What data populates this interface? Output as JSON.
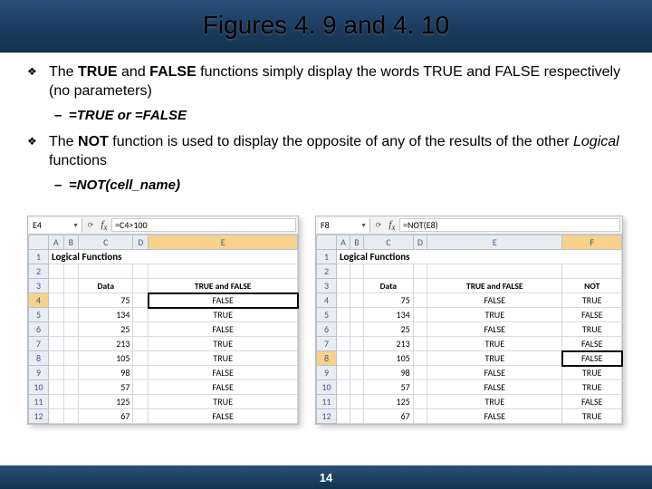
{
  "title": "Figures 4. 9 and 4. 10",
  "bullets": {
    "b1_pre": "The ",
    "b1_bold1": "TRUE",
    "b1_mid1": " and ",
    "b1_bold2": "FALSE",
    "b1_post": " functions simply display the words TRUE and FALSE respectively (no parameters)",
    "b1_sub": "=TRUE or =FALSE",
    "b2_pre": "The ",
    "b2_bold1": "NOT",
    "b2_mid": " function is used to display the opposite of any of the results of the other ",
    "b2_ital": "Logical",
    "b2_post": " functions",
    "b2_sub": "=NOT(cell_name)"
  },
  "left": {
    "namebox": "E4",
    "formula": "=C4>100",
    "cols": [
      "A",
      "B",
      "C",
      "D",
      "E"
    ],
    "sheet_title": "Logical Functions",
    "col_data": "Data",
    "col_tf": "TRUE and FALSE",
    "rows": [
      {
        "n": "1"
      },
      {
        "n": "2"
      },
      {
        "n": "3",
        "data": "",
        "tf": ""
      },
      {
        "n": "4",
        "data": "75",
        "tf": "FALSE"
      },
      {
        "n": "5",
        "data": "134",
        "tf": "TRUE"
      },
      {
        "n": "6",
        "data": "25",
        "tf": "FALSE"
      },
      {
        "n": "7",
        "data": "213",
        "tf": "TRUE"
      },
      {
        "n": "8",
        "data": "105",
        "tf": "TRUE"
      },
      {
        "n": "9",
        "data": "98",
        "tf": "FALSE"
      },
      {
        "n": "10",
        "data": "57",
        "tf": "FALSE"
      },
      {
        "n": "11",
        "data": "125",
        "tf": "TRUE"
      },
      {
        "n": "12",
        "data": "67",
        "tf": "FALSE"
      }
    ]
  },
  "right": {
    "namebox": "F8",
    "formula": "=NOT(E8)",
    "cols": [
      "A",
      "B",
      "C",
      "D",
      "E",
      "F"
    ],
    "sheet_title": "Logical Functions",
    "col_data": "Data",
    "col_tf": "TRUE and FALSE",
    "col_not": "NOT",
    "rows": [
      {
        "n": "1"
      },
      {
        "n": "2"
      },
      {
        "n": "3"
      },
      {
        "n": "4",
        "data": "75",
        "tf": "FALSE",
        "not": "TRUE"
      },
      {
        "n": "5",
        "data": "134",
        "tf": "TRUE",
        "not": "FALSE"
      },
      {
        "n": "6",
        "data": "25",
        "tf": "FALSE",
        "not": "TRUE"
      },
      {
        "n": "7",
        "data": "213",
        "tf": "TRUE",
        "not": "FALSE"
      },
      {
        "n": "8",
        "data": "105",
        "tf": "TRUE",
        "not": "FALSE"
      },
      {
        "n": "9",
        "data": "98",
        "tf": "FALSE",
        "not": "TRUE"
      },
      {
        "n": "10",
        "data": "57",
        "tf": "FALSE",
        "not": "TRUE"
      },
      {
        "n": "11",
        "data": "125",
        "tf": "TRUE",
        "not": "FALSE"
      },
      {
        "n": "12",
        "data": "67",
        "tf": "FALSE",
        "not": "TRUE"
      }
    ]
  },
  "page": "14"
}
